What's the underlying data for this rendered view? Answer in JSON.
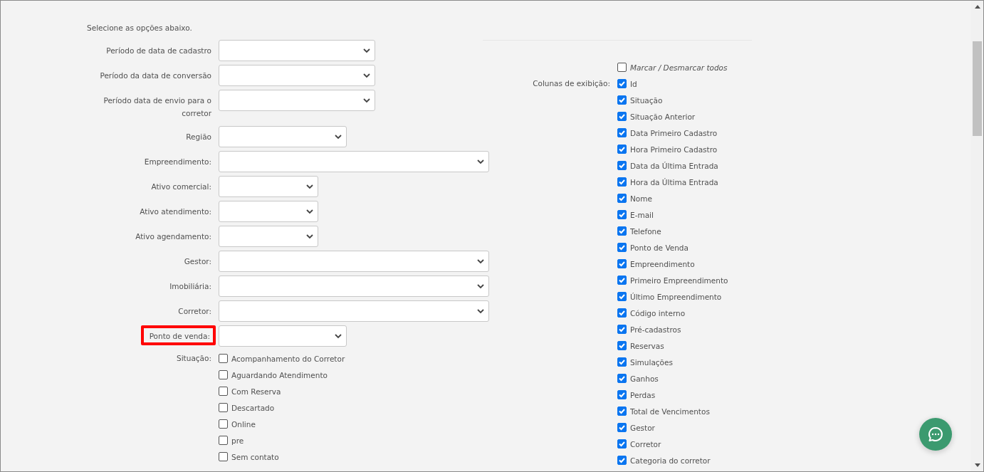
{
  "heading": "Selecione as opções abaixo.",
  "filters": [
    {
      "label": "Período de data de cadastro",
      "kind": "medium",
      "highlighted": false
    },
    {
      "label": "Período da data de conversão",
      "kind": "medium",
      "highlighted": false
    },
    {
      "label": "Período data de envio para o corretor",
      "kind": "medium",
      "highlighted": false
    },
    {
      "label": "Região",
      "kind": "short",
      "highlighted": false
    },
    {
      "label": "Empreendimento:",
      "kind": "wide",
      "highlighted": false
    },
    {
      "label": "Ativo comercial:",
      "kind": "small",
      "highlighted": false
    },
    {
      "label": "Ativo atendimento:",
      "kind": "small",
      "highlighted": false
    },
    {
      "label": "Ativo agendamento:",
      "kind": "small",
      "highlighted": false
    },
    {
      "label": "Gestor:",
      "kind": "wide",
      "highlighted": false
    },
    {
      "label": "Imobiliária:",
      "kind": "wide",
      "highlighted": false
    },
    {
      "label": "Corretor:",
      "kind": "wide",
      "highlighted": false
    },
    {
      "label": "Ponto de venda:",
      "kind": "short",
      "highlighted": true
    }
  ],
  "situacao": {
    "label": "Situação:",
    "options": [
      {
        "label": "Acompanhamento do Corretor",
        "checked": false
      },
      {
        "label": "Aguardando Atendimento",
        "checked": false
      },
      {
        "label": "Com Reserva",
        "checked": false
      },
      {
        "label": "Descartado",
        "checked": false
      },
      {
        "label": "Online",
        "checked": false
      },
      {
        "label": "pre",
        "checked": false
      },
      {
        "label": "Sem contato",
        "checked": false
      }
    ]
  },
  "columns": {
    "label": "Colunas de exibição:",
    "toggle_all": {
      "label": "Marcar / Desmarcar todos",
      "checked": false
    },
    "options": [
      {
        "label": "Id",
        "checked": true
      },
      {
        "label": "Situação",
        "checked": true
      },
      {
        "label": "Situação Anterior",
        "checked": true
      },
      {
        "label": "Data Primeiro Cadastro",
        "checked": true
      },
      {
        "label": "Hora Primeiro Cadastro",
        "checked": true
      },
      {
        "label": "Data da Última Entrada",
        "checked": true
      },
      {
        "label": "Hora da Última Entrada",
        "checked": true
      },
      {
        "label": "Nome",
        "checked": true
      },
      {
        "label": "E-mail",
        "checked": true
      },
      {
        "label": "Telefone",
        "checked": true
      },
      {
        "label": "Ponto de Venda",
        "checked": true
      },
      {
        "label": "Empreendimento",
        "checked": true
      },
      {
        "label": "Primeiro Empreendimento",
        "checked": true
      },
      {
        "label": "Último Empreendimento",
        "checked": true
      },
      {
        "label": "Código interno",
        "checked": true
      },
      {
        "label": "Pré-cadastros",
        "checked": true
      },
      {
        "label": "Reservas",
        "checked": true
      },
      {
        "label": "Simulações",
        "checked": true
      },
      {
        "label": "Ganhos",
        "checked": true
      },
      {
        "label": "Perdas",
        "checked": true
      },
      {
        "label": "Total de Vencimentos",
        "checked": true
      },
      {
        "label": "Gestor",
        "checked": true
      },
      {
        "label": "Corretor",
        "checked": true
      },
      {
        "label": "Categoria do corretor",
        "checked": true
      }
    ]
  }
}
